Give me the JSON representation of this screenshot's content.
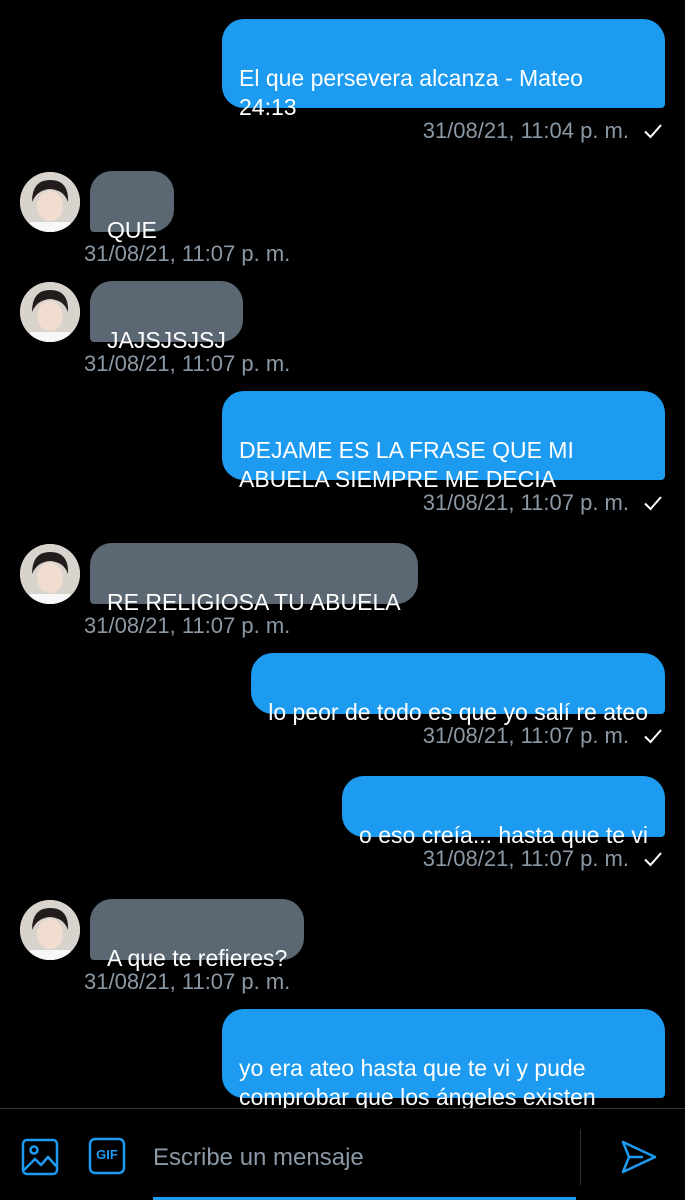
{
  "messages": [
    {
      "direction": "out",
      "text": "El que persevera alcanza - Mateo\n24:13",
      "time": "31/08/21, 11:04 p. m.",
      "status": "sent"
    },
    {
      "direction": "in",
      "text": "QUE",
      "time": "31/08/21, 11:07 p. m."
    },
    {
      "direction": "in",
      "text": "JAJSJSJSJ",
      "time": "31/08/21, 11:07 p. m."
    },
    {
      "direction": "out",
      "text": "DEJAME ES LA FRASE QUE MI\nABUELA SIEMPRE ME DECIA",
      "time": "31/08/21, 11:07 p. m.",
      "status": "sent"
    },
    {
      "direction": "in",
      "text": "RE RELIGIOSA TU ABUELA",
      "time": "31/08/21, 11:07 p. m."
    },
    {
      "direction": "out",
      "text": "lo peor de todo es que yo salí re ateo",
      "time": "31/08/21, 11:07 p. m.",
      "status": "sent"
    },
    {
      "direction": "out",
      "text": "o eso creía... hasta que te vi",
      "time": "31/08/21, 11:07 p. m.",
      "status": "sent"
    },
    {
      "direction": "in",
      "text": "A que te refieres?",
      "time": "31/08/21, 11:07 p. m."
    },
    {
      "direction": "out",
      "text": "yo era ateo hasta que te vi y pude\ncomprobar que los ángeles existen",
      "time": "",
      "status": ""
    }
  ],
  "composer": {
    "placeholder": "Escribe un mensaje",
    "image_icon": "image-icon",
    "gif_icon": "gif-icon",
    "gif_label": "GIF",
    "send_icon": "send-icon"
  },
  "colors": {
    "outgoing_bubble": "#1d9bf0",
    "incoming_bubble": "#5b6773",
    "timestamp": "#8b98a5",
    "background": "#000000",
    "accent": "#1d9bf0"
  }
}
